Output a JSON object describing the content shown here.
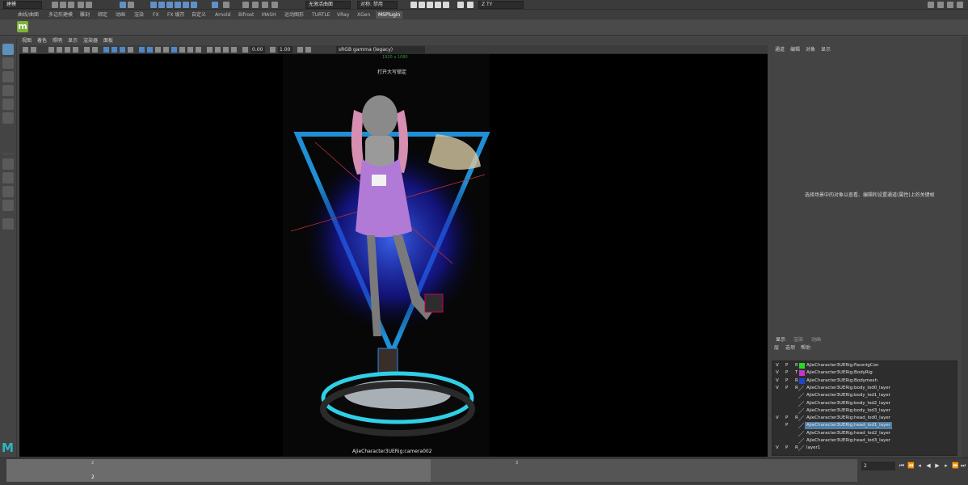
{
  "status_line": {
    "mode": "建模",
    "live_surface": "无激活曲面",
    "symmetry": "对称: 禁用",
    "workspace": "Z TY"
  },
  "shelf_tabs": [
    "曲线/曲面",
    "多边形建模",
    "雕刻",
    "绑定",
    "动画",
    "渲染",
    "FX",
    "FX 缓存",
    "自定义",
    "Arnold",
    "Bifrost",
    "MASH",
    "运动图形",
    "TURTLE",
    "VRay",
    "XGen",
    "MSPlugin"
  ],
  "shelf": {
    "plugin_icon_label": "m"
  },
  "panel_menu": [
    "视图",
    "着色",
    "照明",
    "显示",
    "渲染器",
    "面板"
  ],
  "panel_toolbar": {
    "field_a": "0.00",
    "field_b": "1.00",
    "color_space": "sRGB gamma (legacy)"
  },
  "viewport": {
    "resolution": "1920 x 1080",
    "caps_lock": "打开大写锁定",
    "camera": "AjieCharacter3UERig:camera002"
  },
  "attribute_editor": {
    "menu": [
      "通道",
      "编辑",
      "对象",
      "显示"
    ],
    "message": "选择场景中的对象以查看、编辑和设置通道(属性)上的关键帧"
  },
  "layer_editor": {
    "tabs": [
      "显示",
      "渲染",
      "动画"
    ],
    "active_tab": "显示",
    "menu": [
      "层",
      "选项",
      "帮助"
    ],
    "layers": [
      {
        "v": "V",
        "p": "P",
        "r": "R",
        "color": "#22dd22",
        "name": "AjieCharacter3UERig:FacerigCon"
      },
      {
        "v": "V",
        "p": "P",
        "r": "T",
        "color": "#cc33cc",
        "name": "AjieCharacter3UERig:BodyRig"
      },
      {
        "v": "V",
        "p": "P",
        "r": "R",
        "color": "#2244cc",
        "name": "AjieCharacter3UERig:Bodymesh"
      },
      {
        "v": "V",
        "p": "P",
        "r": "R",
        "color": "",
        "name": "AjieCharacter3UERig:body_lod0_layer"
      },
      {
        "v": "",
        "p": "",
        "r": "",
        "color": "",
        "name": "AjieCharacter3UERig:body_lod1_layer"
      },
      {
        "v": "",
        "p": "",
        "r": "",
        "color": "",
        "name": "AjieCharacter3UERig:body_lod2_layer"
      },
      {
        "v": "",
        "p": "",
        "r": "",
        "color": "",
        "name": "AjieCharacter3UERig:body_lod3_layer"
      },
      {
        "v": "V",
        "p": "P",
        "r": "R",
        "color": "",
        "name": "AjieCharacter3UERig:head_lod0_layer"
      },
      {
        "v": "",
        "p": "P",
        "r": "",
        "color": "",
        "name": "AjieCharacter3UERig:head_lod1_layer",
        "selected": true
      },
      {
        "v": "",
        "p": "",
        "r": "",
        "color": "",
        "name": "AjieCharacter3UERig:head_lod2_layer"
      },
      {
        "v": "",
        "p": "",
        "r": "",
        "color": "",
        "name": "AjieCharacter3UERig:head_lod3_layer"
      },
      {
        "v": "V",
        "p": "P",
        "r": "R",
        "color": "",
        "name": "layer1"
      }
    ]
  },
  "time_slider": {
    "tick_a": "2",
    "tick_b": "3",
    "current_frame": "2",
    "frame_field": "2"
  },
  "colors": {
    "accent": "#5f8fbd",
    "maya": "#2fb5c2",
    "shelf_m": "#7fb33a"
  }
}
